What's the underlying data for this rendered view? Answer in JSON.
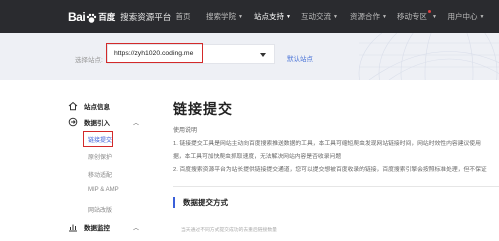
{
  "header": {
    "logo_mark_left": "Bai",
    "logo_mark_right": "百度",
    "logo_text": "搜索资源平台",
    "nav": [
      {
        "label": "首页",
        "active": false
      },
      {
        "label": "搜索学院",
        "active": false
      },
      {
        "label": "站点支持",
        "active": true
      },
      {
        "label": "互动交流",
        "active": false
      },
      {
        "label": "资源合作",
        "active": false
      },
      {
        "label": "移动专区",
        "active": false
      },
      {
        "label": "用户中心",
        "active": false
      }
    ]
  },
  "site_bar": {
    "label": "选择站点:",
    "value": "https://zyh1020.coding.me",
    "default_site_link": "默认站点"
  },
  "sidebar": {
    "site_info": "站点信息",
    "data_import": "数据引入",
    "data_import_items": [
      "链接提交",
      "原创保护",
      "移动适配",
      "MIP & AMP",
      "网站改版"
    ],
    "data_monitor": "数据监控",
    "icons": {
      "site_info": "home-icon",
      "data_import": "data-import-icon",
      "data_monitor": "chart-icon"
    }
  },
  "main": {
    "title": "链接提交",
    "usage_title": "使用说明",
    "usage_lines": [
      "1. 链接提交工具是网站主动向百度搜索推送数据的工具，本工具可缩短爬虫发现网站链接时间，网站时效性内容建议使用",
      "据，本工具可加快爬虫抓取速度，无法解决网站内容是否收录问题",
      "2. 百度搜索资源平台为站长提供链接提交通道，您可以提交想被百度收录的链接，百度搜索引擎会按照标准处理，但不保证"
    ],
    "section_title": "数据提交方式",
    "footnote": "当天通过不同方式提交成功的去重后链接数量"
  },
  "colors": {
    "topbar": "#2a2b2f",
    "accent": "#3a5fd9",
    "highlight": "#d32a2a",
    "band": "#eef0f5"
  }
}
